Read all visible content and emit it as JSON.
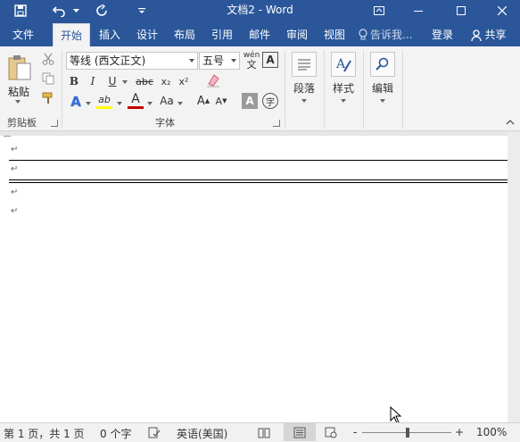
{
  "window": {
    "title": "文档2 - Word",
    "save_icon": "save-icon",
    "undo_icon": "undo-icon",
    "redo_icon": "redo-icon",
    "customize_icon": "customize-toolbar-icon",
    "ribbon_display_icon": "ribbon-display-options-icon",
    "minimize_icon": "minimize-icon",
    "maximize_icon": "maximize-icon",
    "close_icon": "close-icon"
  },
  "tabs": [
    {
      "label": "文件"
    },
    {
      "label": "开始"
    },
    {
      "label": "插入"
    },
    {
      "label": "设计"
    },
    {
      "label": "布局"
    },
    {
      "label": "引用"
    },
    {
      "label": "邮件"
    },
    {
      "label": "审阅"
    },
    {
      "label": "视图"
    }
  ],
  "active_tab": "开始",
  "tell_me": {
    "placeholder": "告诉我...",
    "icon": "lightbulb-icon"
  },
  "account": {
    "login_label": "登录",
    "share_label": "共享",
    "share_icon": "person-icon"
  },
  "ribbon": {
    "clipboard": {
      "group_label": "剪贴板",
      "paste_label": "粘贴",
      "cut_icon": "scissors-icon",
      "copy_icon": "copy-icon",
      "format_painter_icon": "format-painter-icon"
    },
    "font": {
      "group_label": "字体",
      "font_name": "等线 (西文正文)",
      "font_size": "五号",
      "phonetic_label": "wén",
      "char_border_label": "A",
      "bold": "B",
      "italic": "I",
      "underline": "U",
      "strikethrough": "abc",
      "subscript": "x₂",
      "superscript": "x²",
      "text_effects": "A",
      "highlight": "ab",
      "font_color": "A",
      "change_case": "Aa",
      "grow_font": "A",
      "shrink_font": "A",
      "char_shading": "A",
      "enclose_char": "字"
    },
    "paragraph_label": "段落",
    "styles_label": "样式",
    "editing_label": "编辑"
  },
  "document": {
    "paragraph_mark": "↵"
  },
  "status": {
    "page": "第 1 页，共 1 页",
    "words": "0 个字",
    "language": "英语(美国)",
    "zoom_minus": "-",
    "zoom_plus": "+",
    "zoom": "100%"
  },
  "colors": {
    "brand": "#2b579a",
    "font_color_bar": "#c00000",
    "highlight_bar": "#ffff00"
  }
}
